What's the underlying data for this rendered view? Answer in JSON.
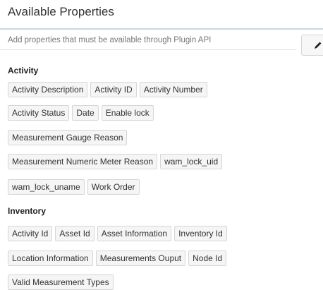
{
  "header": {
    "title": "Available Properties",
    "hint": "Add properties that must be available through Plugin API",
    "edit_icon": "pencil-icon"
  },
  "groups": [
    {
      "heading": "Activity",
      "rows": [
        [
          "Activity Description",
          "Activity ID",
          "Activity Number"
        ],
        [
          "Activity Status",
          "Date",
          "Enable lock"
        ],
        [
          "Measurement Gauge Reason"
        ],
        [
          "Measurement Numeric Meter Reason",
          "wam_lock_uid"
        ],
        [
          "wam_lock_uname",
          "Work Order"
        ]
      ]
    },
    {
      "heading": "Inventory",
      "rows": [
        [
          "Activity Id",
          "Asset Id",
          "Asset Information",
          "Inventory Id"
        ],
        [
          "Location Information",
          "Measurements Ouput",
          "Node Id"
        ],
        [
          "Valid Measurement Types"
        ]
      ]
    }
  ]
}
